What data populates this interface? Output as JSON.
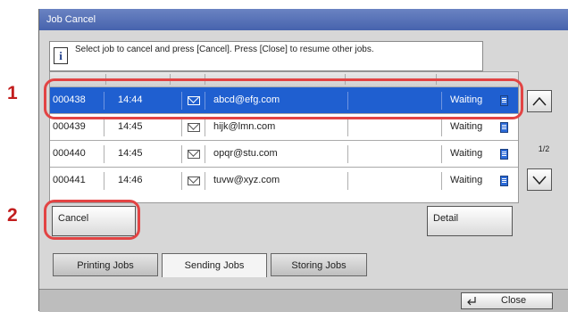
{
  "steps": [
    "1",
    "2"
  ],
  "dialog": {
    "title": "Job Cancel",
    "instruction": "Select job to cancel and press [Cancel]. Press [Close] to resume other jobs."
  },
  "jobs": [
    {
      "id": "000438",
      "time": "14:44",
      "dest": "abcd@efg.com",
      "status": "Waiting",
      "selected": true
    },
    {
      "id": "000439",
      "time": "14:45",
      "dest": "hijk@lmn.com",
      "status": "Waiting",
      "selected": false
    },
    {
      "id": "000440",
      "time": "14:45",
      "dest": "opqr@stu.com",
      "status": "Waiting",
      "selected": false
    },
    {
      "id": "000441",
      "time": "14:46",
      "dest": "tuvw@xyz.com",
      "status": "Waiting",
      "selected": false
    }
  ],
  "pager": "1/2",
  "buttons": {
    "cancel": "Cancel",
    "detail": "Detail",
    "close": "Close"
  },
  "tabs": [
    "Printing Jobs",
    "Sending Jobs",
    "Storing Jobs"
  ],
  "icons": {
    "info": "info-icon",
    "mail": "mail-icon",
    "doc": "document-icon",
    "up": "chevron-up-icon",
    "down": "chevron-down-icon",
    "close": "return-arrow-icon"
  },
  "colors": {
    "titlebar": "#4f6bb4",
    "selection": "#1f5fd0",
    "highlight": "#e24444",
    "step_number": "#c21d1d"
  }
}
